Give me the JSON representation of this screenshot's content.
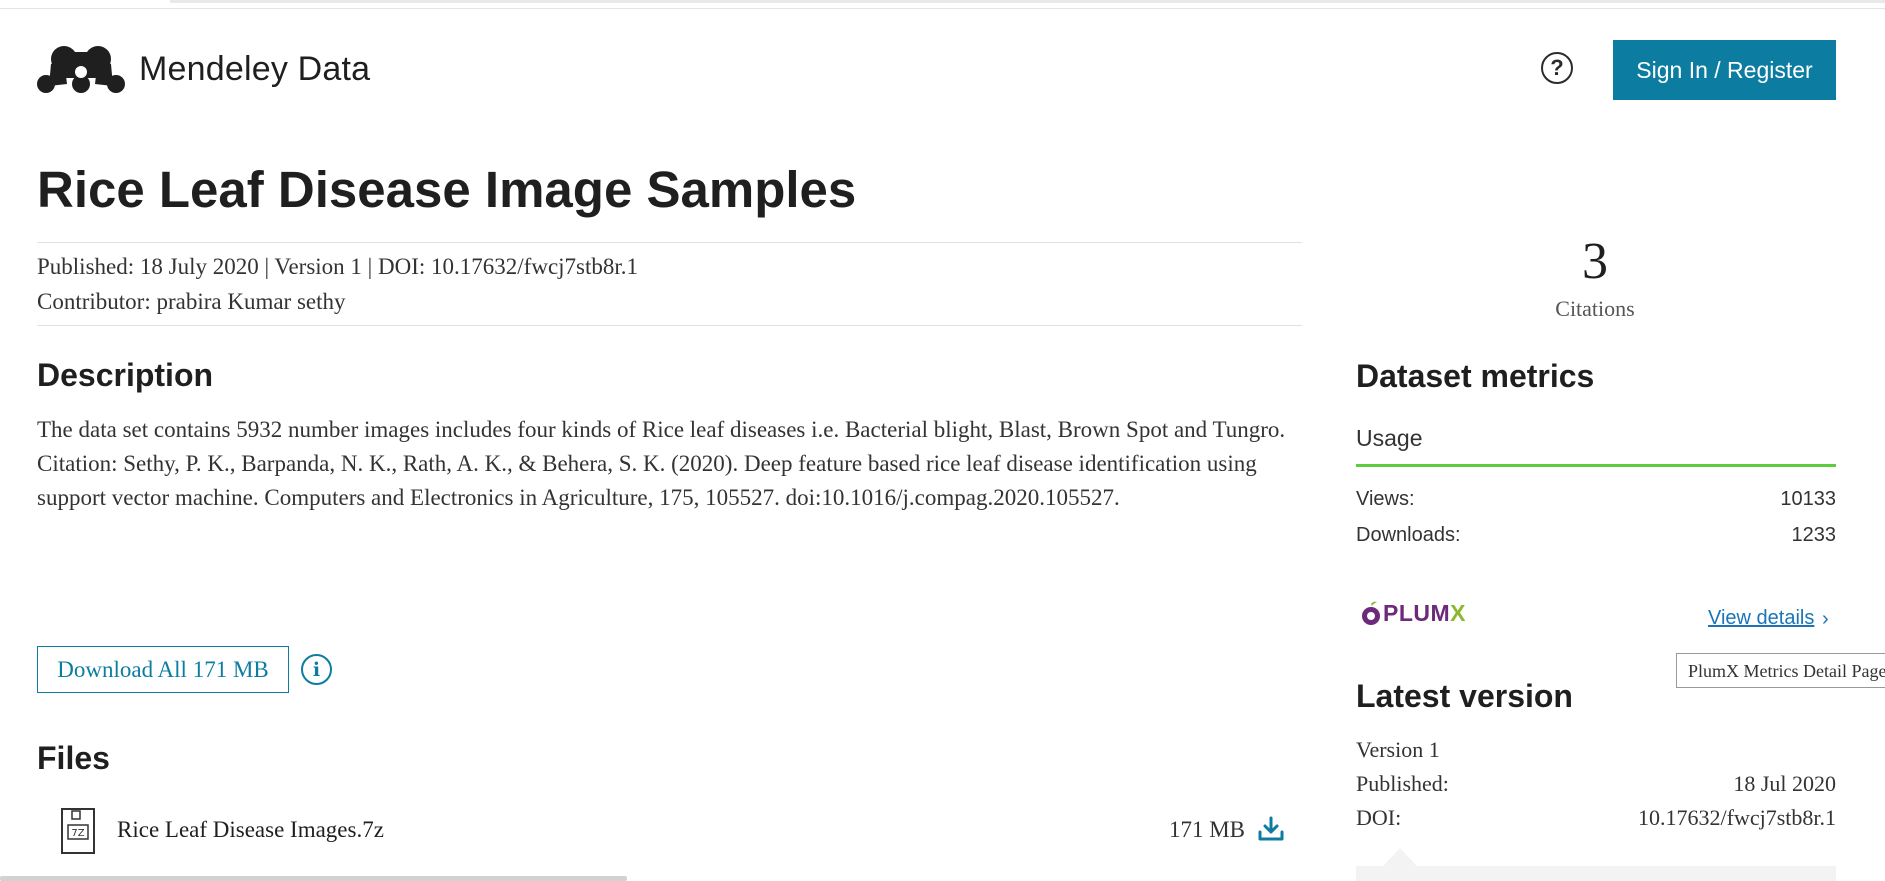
{
  "header": {
    "brand": "Mendeley Data",
    "sign_in_label": "Sign In / Register"
  },
  "dataset": {
    "title": "Rice Leaf Disease Image Samples",
    "published_line": "Published: 18 July 2020 | Version 1 | DOI: 10.17632/fwcj7stb8r.1",
    "contributor_line": "Contributor:  prabira Kumar sethy"
  },
  "description": {
    "heading": "Description",
    "paragraph1": " The data set contains  5932 number images includes four kinds of Rice leaf diseases i.e. Bacterial blight, Blast, Brown Spot and Tungro.",
    "paragraph2": "Citation: Sethy, P. K., Barpanda, N. K., Rath, A. K., & Behera, S. K. (2020). Deep feature based rice leaf disease identification using support vector machine. Computers and Electronics in Agriculture, 175, 105527. doi:10.1016/j.compag.2020.105527."
  },
  "download": {
    "label": "Download All 171 MB"
  },
  "files": {
    "heading": "Files",
    "items": [
      {
        "icon_label": "7Z",
        "name": "Rice Leaf Disease Images.7z",
        "size": "171 MB"
      }
    ]
  },
  "citations": {
    "count": "3",
    "label": "Citations"
  },
  "metrics": {
    "heading": "Dataset metrics",
    "tab": "Usage",
    "views_label": "Views:",
    "views_value": "10133",
    "downloads_label": "Downloads:",
    "downloads_value": "1233",
    "plumx_brand": "PLUMX",
    "view_details": "View details",
    "tooltip": "PlumX Metrics Detail Page"
  },
  "latest_version": {
    "heading": "Latest version",
    "version": "Version 1",
    "published_label": "Published:",
    "published_value": "18 Jul 2020",
    "doi_label": "DOI:",
    "doi_value": "10.17632/fwcj7stb8r.1"
  },
  "colors": {
    "brand_blue": "#0c7da1",
    "usage_green": "#5fcb3f",
    "link_blue": "#1a75b8",
    "plumx_purple": "#6d2a7a"
  }
}
